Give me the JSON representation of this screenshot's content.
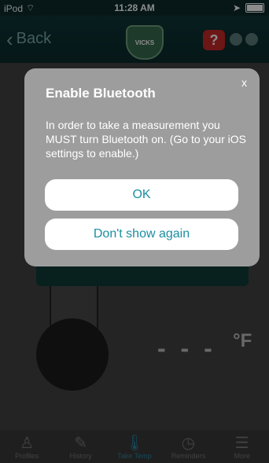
{
  "status_bar": {
    "carrier": "iPod",
    "time": "11:28 AM"
  },
  "nav": {
    "back_label": "Back",
    "logo_text": "VICKS",
    "help_symbol": "?"
  },
  "thermometer": {
    "reading": "- - -",
    "unit": "°F"
  },
  "tabs": [
    {
      "label": "Profiles",
      "icon": "person-icon"
    },
    {
      "label": "History",
      "icon": "history-icon"
    },
    {
      "label": "Take Temp",
      "icon": "thermometer-icon",
      "active": true
    },
    {
      "label": "Reminders",
      "icon": "clock-icon"
    },
    {
      "label": "More",
      "icon": "menu-icon"
    }
  ],
  "dialog": {
    "close": "x",
    "title": "Enable Bluetooth",
    "message": "In order to take a measurement you MUST turn Bluetooth on. (Go to your iOS settings to enable.)",
    "ok_label": "OK",
    "dont_show_label": "Don't show again"
  },
  "colors": {
    "accent": "#1b8fa2",
    "dialog_bg": "#9d9d9d",
    "nav_bg": "#0f3536"
  }
}
